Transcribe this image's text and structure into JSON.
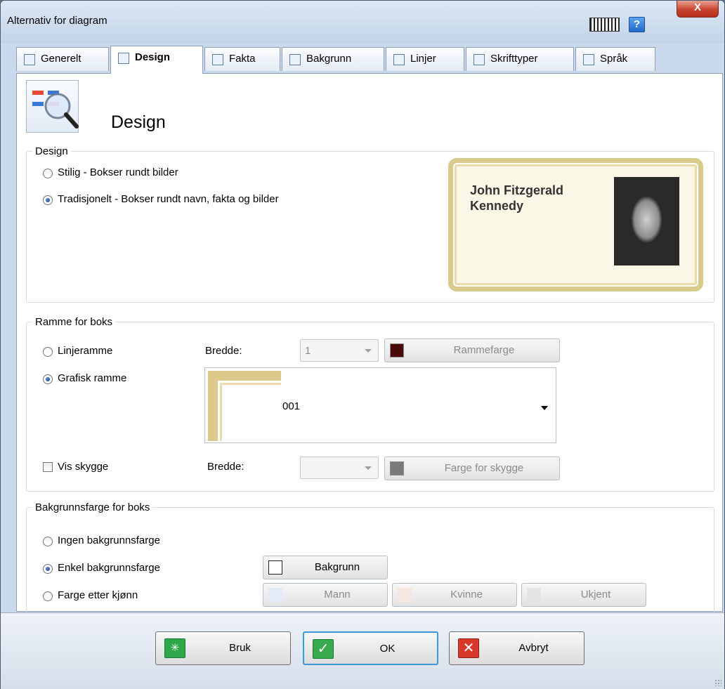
{
  "window": {
    "title": "Alternativ for diagram",
    "help_label": "?",
    "close_label": "X"
  },
  "tabs": [
    {
      "label": "Generelt"
    },
    {
      "label": "Design"
    },
    {
      "label": "Fakta"
    },
    {
      "label": "Bakgrunn"
    },
    {
      "label": "Linjer"
    },
    {
      "label": "Skrifttyper"
    },
    {
      "label": "Språk"
    }
  ],
  "active_tab": "Design",
  "header": {
    "title": "Design"
  },
  "design_group": {
    "legend": "Design",
    "options": [
      {
        "label": "Stilig - Bokser rundt bilder",
        "checked": false
      },
      {
        "label": "Tradisjonelt - Bokser rundt navn, fakta og bilder",
        "checked": true
      }
    ],
    "preview_name_line1": "John Fitzgerald",
    "preview_name_line2": "Kennedy"
  },
  "frame_group": {
    "legend": "Ramme for boks",
    "line_frame_label": "Linjeramme",
    "graphic_frame_label": "Grafisk ramme",
    "width_label": "Bredde:",
    "width_value": "1",
    "frame_color_button": "Rammefarge",
    "frame_color": "#4a0a0a",
    "graphic_frame_value": "001",
    "shadow_label": "Vis skygge",
    "shadow_width_label": "Bredde:",
    "shadow_color_button": "Farge for skygge",
    "shadow_color": "#7a7a7a"
  },
  "bg_group": {
    "legend": "Bakgrunnsfarge for boks",
    "no_bg_label": "Ingen bakgrunnsfarge",
    "simple_bg_label": "Enkel bakgrunnsfarge",
    "by_gender_label": "Farge etter kjønn",
    "bg_button": "Bakgrunn",
    "male_button": "Mann",
    "female_button": "Kvinne",
    "unknown_button": "Ukjent",
    "bg_color": "#ffffff",
    "male_color": "#e4eaf8",
    "female_color": "#f8e6e2",
    "unknown_color": "#e4e4e4"
  },
  "footer": {
    "apply_label": "Bruk",
    "ok_label": "OK",
    "cancel_label": "Avbryt"
  }
}
